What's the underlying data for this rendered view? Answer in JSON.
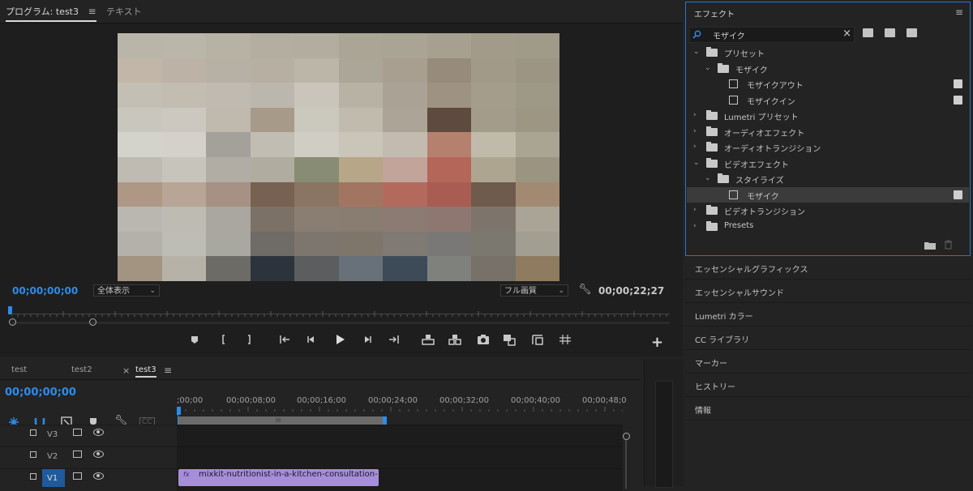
{
  "program": {
    "tab_label": "プログラム: test3",
    "menu_icon": "≡",
    "text_tab": "テキスト",
    "timecode_current": "00;00;00;00",
    "zoom_select": "全体表示",
    "quality_select": "フル画質",
    "timecode_duration": "00;00;22;27"
  },
  "video_mosaic": [
    [
      "#b9b5a8",
      "#bab6a9",
      "#b6b3a5",
      "#b3ae9f",
      "#b2ad9e",
      "#aaa595",
      "#a9a493",
      "#a7a090",
      "#a29b8a",
      "#a09a89"
    ],
    [
      "#c1b6a7",
      "#bcb3a6",
      "#b7b0a5",
      "#b7b0a2",
      "#bcb6a8",
      "#aca699",
      "#a89f90",
      "#978b7c",
      "#a29a88",
      "#9c9583"
    ],
    [
      "#c3bfb5",
      "#c2bcb1",
      "#c0bbb1",
      "#bcb7ac",
      "#c9c5ba",
      "#b8b2a5",
      "#aaa294",
      "#9e9282",
      "#a49d8b",
      "#9e9886"
    ],
    [
      "#c9c6be",
      "#ccc8bf",
      "#bfb9ae",
      "#a89a89",
      "#cbc8bd",
      "#c0bbad",
      "#aca597",
      "#5e4a3e",
      "#a39c8a",
      "#9d9683"
    ],
    [
      "#d3d2cb",
      "#d3d1c9",
      "#a4a09a",
      "#c2bdb3",
      "#cfcdc4",
      "#c9c5b9",
      "#c3bbb0",
      "#b6806f",
      "#c0baab",
      "#aaa593"
    ],
    [
      "#bfbbb2",
      "#c7c4bc",
      "#b1ada5",
      "#b0ac9f",
      "#898c74",
      "#b7a688",
      "#c2a49a",
      "#b46658",
      "#aea590",
      "#9a9480"
    ],
    [
      "#ae9784",
      "#b8a595",
      "#a79184",
      "#776151",
      "#8a7562",
      "#a27562",
      "#b36a5d",
      "#a95c52",
      "#6e5b4c",
      "#a28a72"
    ],
    [
      "#b9b7b0",
      "#bdbbb2",
      "#aaa7a0",
      "#7c7166",
      "#8a7d72",
      "#897c71",
      "#8c7b72",
      "#8e7770",
      "#7d756b",
      "#a9a496"
    ],
    [
      "#b3b1aa",
      "#bdbdb6",
      "#a8a7a0",
      "#6f6b66",
      "#7d766e",
      "#7e766b",
      "#7f7a73",
      "#7a7877",
      "#7b786f",
      "#a29e92"
    ],
    [
      "#a39381",
      "#b6b2a8",
      "#6c6b66",
      "#2c333c",
      "#5c5d5e",
      "#687179",
      "#3d4b59",
      "#7f817d",
      "#777169",
      "#8f7b60"
    ]
  ],
  "transport_icons": [
    "marker-icon",
    "mark-in-icon",
    "mark-out-icon",
    "go-to-in-icon",
    "step-back-icon",
    "play-icon",
    "step-forward-icon",
    "go-to-out-icon",
    "lift-icon",
    "extract-icon",
    "export-frame-icon",
    "comparison-view-icon",
    "insert-icon",
    "trim-icon"
  ],
  "effects": {
    "title": "エフェクト",
    "search_value": "モザイク",
    "clear_icon": "×",
    "tree": [
      {
        "label": "プリセット",
        "depth": 0,
        "expanded": true,
        "icon": "preset-folder"
      },
      {
        "label": "モザイク",
        "depth": 1,
        "expanded": true,
        "icon": "preset-folder"
      },
      {
        "label": "モザイクアウト",
        "depth": 2,
        "icon": "preset",
        "badge": true
      },
      {
        "label": "モザイクイン",
        "depth": 2,
        "icon": "preset",
        "badge": true
      },
      {
        "label": "Lumetri プリセット",
        "depth": 0,
        "expanded": false,
        "icon": "preset-folder"
      },
      {
        "label": "オーディオエフェクト",
        "depth": 0,
        "expanded": false,
        "icon": "folder"
      },
      {
        "label": "オーディオトランジション",
        "depth": 0,
        "expanded": false,
        "icon": "folder"
      },
      {
        "label": "ビデオエフェクト",
        "depth": 0,
        "expanded": true,
        "icon": "folder"
      },
      {
        "label": "スタイライズ",
        "depth": 1,
        "expanded": true,
        "icon": "folder"
      },
      {
        "label": "モザイク",
        "depth": 2,
        "icon": "effect",
        "badge": true,
        "selected": true
      },
      {
        "label": "ビデオトランジション",
        "depth": 0,
        "expanded": false,
        "icon": "folder"
      },
      {
        "label": "Presets",
        "depth": 0,
        "expanded": false,
        "icon": "preset-folder"
      }
    ]
  },
  "collapsed_panels": [
    "エッセンシャルグラフィックス",
    "エッセンシャルサウンド",
    "Lumetri カラー",
    "CC ライブラリ",
    "マーカー",
    "ヒストリー",
    "情報"
  ],
  "timeline": {
    "tabs": [
      "test",
      "test2",
      "test3"
    ],
    "close_icon": "×",
    "menu_icon": "≡",
    "timecode": "00;00;00;00",
    "cc_label": "CC",
    "ruler": [
      ";00;00",
      "00;00;08;00",
      "00;00;16;00",
      "00;00;24;00",
      "00;00;32;00",
      "00;00;40;00",
      "00;00;48;0"
    ],
    "tracks": [
      "V3",
      "V2",
      "V1"
    ],
    "clip_label": "mixkit-nutritionist-in-a-kitchen-consultation-",
    "clip_fx": "fx",
    "work_area_mark": "III"
  },
  "colors": {
    "accent": "#2d8ceb",
    "clip": "#a68ed9",
    "work_area": "#d4c84a"
  }
}
